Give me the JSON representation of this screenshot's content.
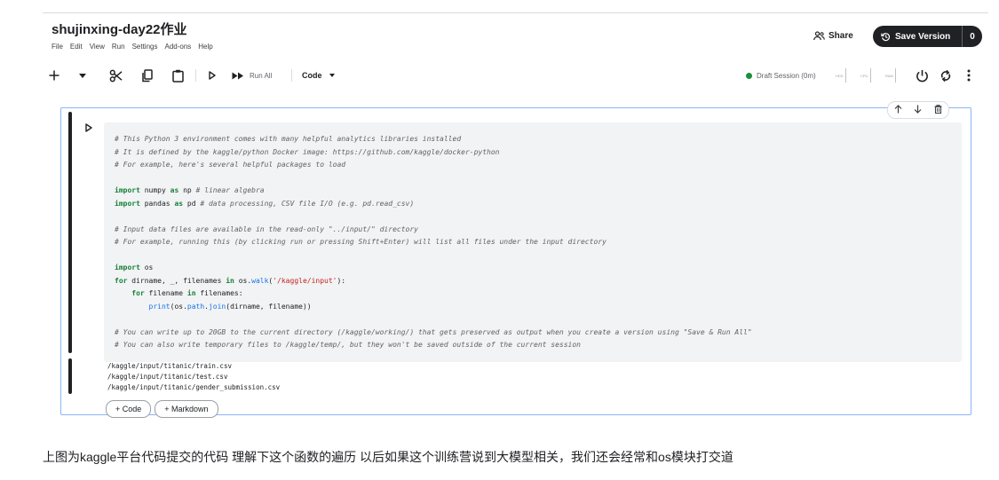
{
  "notebook": {
    "title": "shujinxing-day22作业",
    "menu": [
      "File",
      "Edit",
      "View",
      "Run",
      "Settings",
      "Add-ons",
      "Help"
    ],
    "share_label": "Share",
    "save_version_label": "Save Version",
    "save_version_count": "0"
  },
  "toolbar": {
    "run_all_label": "Run All",
    "cell_type": "Code",
    "session_status": "Draft Session (0m)",
    "meters": [
      "HDD",
      "CPU",
      "RAM"
    ],
    "status_color": "#1e8e3e"
  },
  "cell": {
    "code_lines": [
      "# This Python 3 environment comes with many helpful analytics libraries installed",
      "# It is defined by the kaggle/python Docker image: https://github.com/kaggle/docker-python",
      "# For example, here's several helpful packages to load",
      "",
      "import numpy as np # linear algebra",
      "import pandas as pd # data processing, CSV file I/O (e.g. pd.read_csv)",
      "",
      "# Input data files are available in the read-only \"../input/\" directory",
      "# For example, running this (by clicking run or pressing Shift+Enter) will list all files under the input directory",
      "",
      "import os",
      "for dirname, _, filenames in os.walk('/kaggle/input'):",
      "    for filename in filenames:",
      "        print(os.path.join(dirname, filename))",
      "",
      "# You can write up to 20GB to the current directory (/kaggle/working/) that gets preserved as output when you create a version using \"Save & Run All\"",
      "# You can also write temporary files to /kaggle/temp/, but they won't be saved outside of the current session"
    ],
    "output_lines": [
      "/kaggle/input/titanic/train.csv",
      "/kaggle/input/titanic/test.csv",
      "/kaggle/input/titanic/gender_submission.csv"
    ],
    "add_code_label": "+ Code",
    "add_markdown_label": "+ Markdown"
  },
  "caption": "上图为kaggle平台代码提交的代码 理解下这个函数的遍历 以后如果这个训练营说到大模型相关，我们还会经常和os模块打交道"
}
